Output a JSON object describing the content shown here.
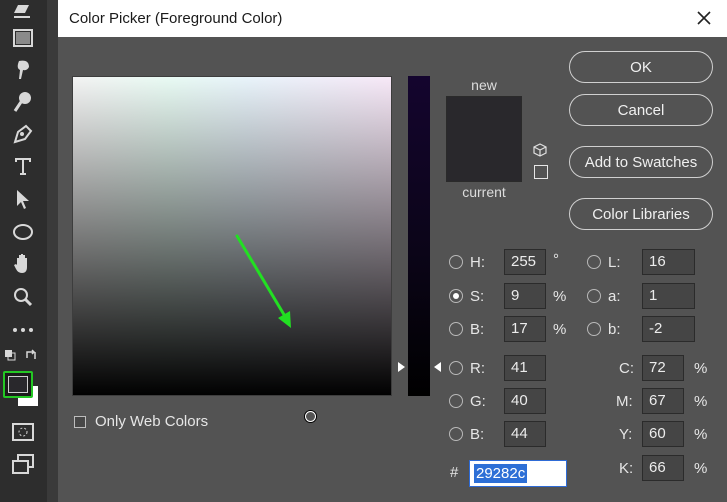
{
  "dialog": {
    "title": "Color Picker (Foreground Color)"
  },
  "preview": {
    "new_label": "new",
    "current_label": "current",
    "color": "#29282c"
  },
  "buttons": {
    "ok": "OK",
    "cancel": "Cancel",
    "add_to_swatches": "Add to Swatches",
    "color_libraries": "Color Libraries"
  },
  "web_colors": {
    "label": "Only Web Colors",
    "checked": false
  },
  "hsb": {
    "h": {
      "label": "H:",
      "value": "255",
      "unit": "°"
    },
    "s": {
      "label": "S:",
      "value": "9",
      "unit": "%"
    },
    "b": {
      "label": "B:",
      "value": "17",
      "unit": "%"
    }
  },
  "rgb": {
    "r": {
      "label": "R:",
      "value": "41"
    },
    "g": {
      "label": "G:",
      "value": "40"
    },
    "b": {
      "label": "B:",
      "value": "44"
    }
  },
  "lab": {
    "l": {
      "label": "L:",
      "value": "16"
    },
    "a": {
      "label": "a:",
      "value": "1"
    },
    "b": {
      "label": "b:",
      "value": "-2"
    }
  },
  "cmyk": {
    "c": {
      "label": "C:",
      "value": "72",
      "unit": "%"
    },
    "m": {
      "label": "M:",
      "value": "67",
      "unit": "%"
    },
    "y": {
      "label": "Y:",
      "value": "60",
      "unit": "%"
    },
    "k": {
      "label": "K:",
      "value": "66",
      "unit": "%"
    }
  },
  "hex": {
    "label": "#",
    "value": "29282c"
  },
  "selected_mode": "S",
  "colors": {
    "foreground": "#29282c",
    "background": "#ffffff",
    "highlight": "#24c724",
    "annotation_arrow": "#22e022"
  },
  "toolbar_icons": [
    "eraser-icon",
    "gradient-icon",
    "smudge-icon",
    "dodge-icon",
    "pen-icon",
    "type-icon",
    "path-selection-icon",
    "ellipse-icon",
    "hand-icon",
    "zoom-icon",
    "more-tools-icon",
    "default-colors-icon",
    "swap-colors-icon",
    "quick-mask-icon",
    "screen-mode-icon"
  ]
}
